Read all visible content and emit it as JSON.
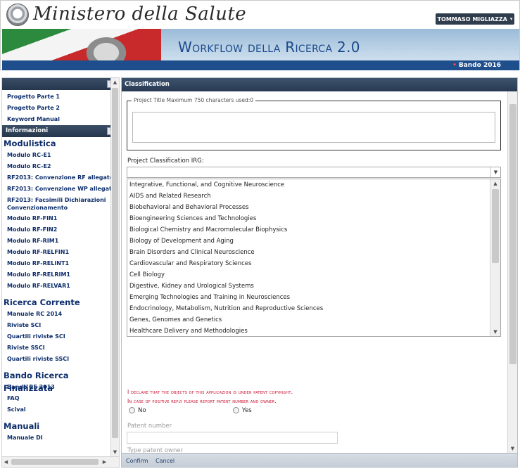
{
  "header": {
    "ministry_name": "Ministero della Salute",
    "user_name": "TOMMASO MIGLIAZZA",
    "app_title": "Workflow della Ricerca 2.0",
    "bando": "Bando 2016"
  },
  "sidebar": {
    "top_links": [
      "Progetto Parte 1",
      "Progetto Parte 2",
      "Keyword Manual"
    ],
    "info_header": "Informazioni",
    "sections": [
      {
        "title": "Modulistica",
        "links": [
          "Modulo RC-E1",
          "Modulo RC-E2",
          "RF2013: Convenzione RF allegato 1",
          "RF2013: Convenzione WP allegato 1",
          "RF2013: Facsimili Dichiarazioni Convenzionamento",
          "Modulo RF-FIN1",
          "Modulo RF-FIN2",
          "Modulo RF-RIM1",
          "Modulo RF-RELFIN1",
          "Modulo RF-RELINT1",
          "Modulo RF-RELRIM1",
          "Modulo RF-RELVAR1"
        ]
      },
      {
        "title": "Ricerca Corrente",
        "links": [
          "Manuale RC 2014",
          "Riviste SCI",
          "Quartili riviste SCI",
          "Riviste SSCI",
          "Quartili riviste SSCI"
        ]
      },
      {
        "title": "Bando Ricerca Finalizzata",
        "links": [
          "Bando RF 2013",
          "FAQ",
          "Scival"
        ]
      },
      {
        "title": "Manuali",
        "links": [
          "Manuale DI"
        ]
      }
    ]
  },
  "main": {
    "panel_title": "Classification",
    "project_title_legend": "Project Title Maximum 750 characters used:0",
    "project_title_value": "",
    "irg_label": "Project Classification IRG:",
    "irg_selected": "",
    "irg_options": [
      "Integrative, Functional, and Cognitive Neuroscience",
      "AIDS and Related Research",
      "Biobehavioral and Behavioral Processes",
      "Bioengineering Sciences and Technologies",
      "Biological Chemistry and Macromolecular Biophysics",
      "Biology of Development and Aging",
      "Brain Disorders and Clinical Neuroscience",
      "Cardiovascular and Respiratory Sciences",
      "Cell Biology",
      "Digestive, Kidney and Urological Systems",
      "Emerging Technologies and Training in Neurosciences",
      "Endocrinology, Metabolism, Nutrition and Reproductive Sciences",
      "Genes, Genomes and Genetics",
      "Healthcare Delivery and Methodologies"
    ],
    "declare_line1": "I declare that the objects of this applicazion is under patent copyright.",
    "declare_line2": "In case of positive reply please report patent number and owner.",
    "radio_no": "No",
    "radio_yes": "Yes",
    "patent_number_label": "Patent number",
    "patent_number_value": "",
    "type_patent_label": "Type patent owner"
  },
  "footer": {
    "confirm": "Confirm",
    "cancel": "Cancel"
  },
  "colors": {
    "accent_blue": "#1f4e8c",
    "nav_dark": "#283a52",
    "link_navy": "#0c2d6b",
    "warning_red": "#c8102e"
  }
}
